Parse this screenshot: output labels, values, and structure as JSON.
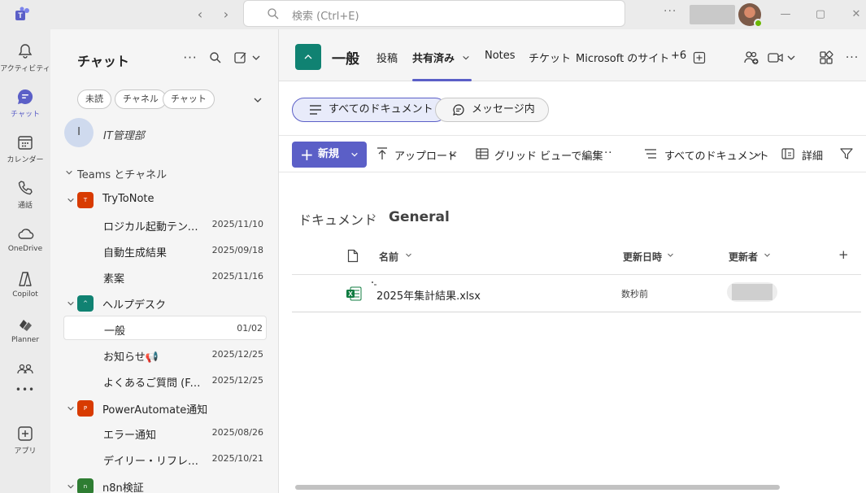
{
  "titlebar": {
    "search_placeholder": "検索 (Ctrl+E)",
    "more": "···"
  },
  "rail": {
    "items": [
      {
        "label": "アクティビティ",
        "icon": "bell-icon"
      },
      {
        "label": "チャット",
        "icon": "chat-icon",
        "active": true
      },
      {
        "label": "カレンダー",
        "icon": "calendar-icon"
      },
      {
        "label": "通話",
        "icon": "phone-icon"
      },
      {
        "label": "OneDrive",
        "icon": "cloud-icon"
      },
      {
        "label": "Copilot",
        "icon": "copilot-icon"
      },
      {
        "label": "Planner",
        "icon": "planner-icon"
      },
      {
        "label": "",
        "icon": "apps-group-icon"
      },
      {
        "label": "",
        "icon": "more-icon"
      },
      {
        "label": "アプリ",
        "icon": "add-app-icon"
      }
    ],
    "more": "•••"
  },
  "chatpane": {
    "title": "チャット",
    "more": "···",
    "filters": [
      "未読",
      "チャネル",
      "チャット"
    ],
    "pinned": {
      "avatar_initial": "I",
      "name": "IT管理部"
    },
    "section": "Teams とチャネル",
    "teams": [
      {
        "name": "TryToNote",
        "badge": "T",
        "badge_color": "#d83b01",
        "channels": [
          {
            "name": "ロジカル起動テンプレ",
            "date": "2025/11/10"
          },
          {
            "name": "自動生成結果",
            "date": "2025/09/18"
          },
          {
            "name": "素案",
            "date": "2025/11/16"
          }
        ]
      },
      {
        "name": "ヘルプデスク",
        "badge": "^",
        "badge_color": "#108272",
        "channels": [
          {
            "name": "一般",
            "date": "01/02",
            "selected": true
          },
          {
            "name": "お知らせ📢",
            "date": "2025/12/25"
          },
          {
            "name": "よくあるご質問 (FA...",
            "date": "2025/12/25"
          }
        ]
      },
      {
        "name": "PowerAutomate通知",
        "badge": "P",
        "badge_color": "#d83b01",
        "channels": [
          {
            "name": "エラー通知",
            "date": "2025/08/26"
          },
          {
            "name": "デイリー・リフレクシ...",
            "date": "2025/10/21"
          }
        ]
      },
      {
        "name": "n8n検証",
        "badge": "n",
        "badge_color": "#2e7d32",
        "channels": []
      }
    ]
  },
  "main": {
    "channel_name": "一般",
    "tabs": [
      {
        "label": "投稿"
      },
      {
        "label": "共有済み",
        "active": true
      },
      {
        "label": "Notes"
      },
      {
        "label": "チケット"
      },
      {
        "label": "Microsoft のサイト"
      },
      {
        "label": "+6"
      }
    ],
    "pills": [
      {
        "label": "すべてのドキュメント",
        "active": true
      },
      {
        "label": "メッセージ内",
        "active": false
      }
    ],
    "commands": {
      "new": "新規",
      "upload": "アップロード",
      "grid_edit": "グリッド ビューで編集",
      "more": "···",
      "view": "すべてのドキュメント",
      "details": "詳細"
    },
    "breadcrumb": {
      "root": "ドキュメント",
      "sep": "›",
      "current": "General"
    },
    "columns": {
      "name": "名前",
      "modified": "更新日時",
      "modified_by": "更新者",
      "add": "+"
    },
    "files": [
      {
        "name": "2025年集計結果.xlsx",
        "modified": "数秒前",
        "icon": "excel-icon"
      }
    ]
  },
  "colors": {
    "accent": "#5b5fc7",
    "channel_teal": "#108272",
    "excel_green": "#107c41"
  }
}
